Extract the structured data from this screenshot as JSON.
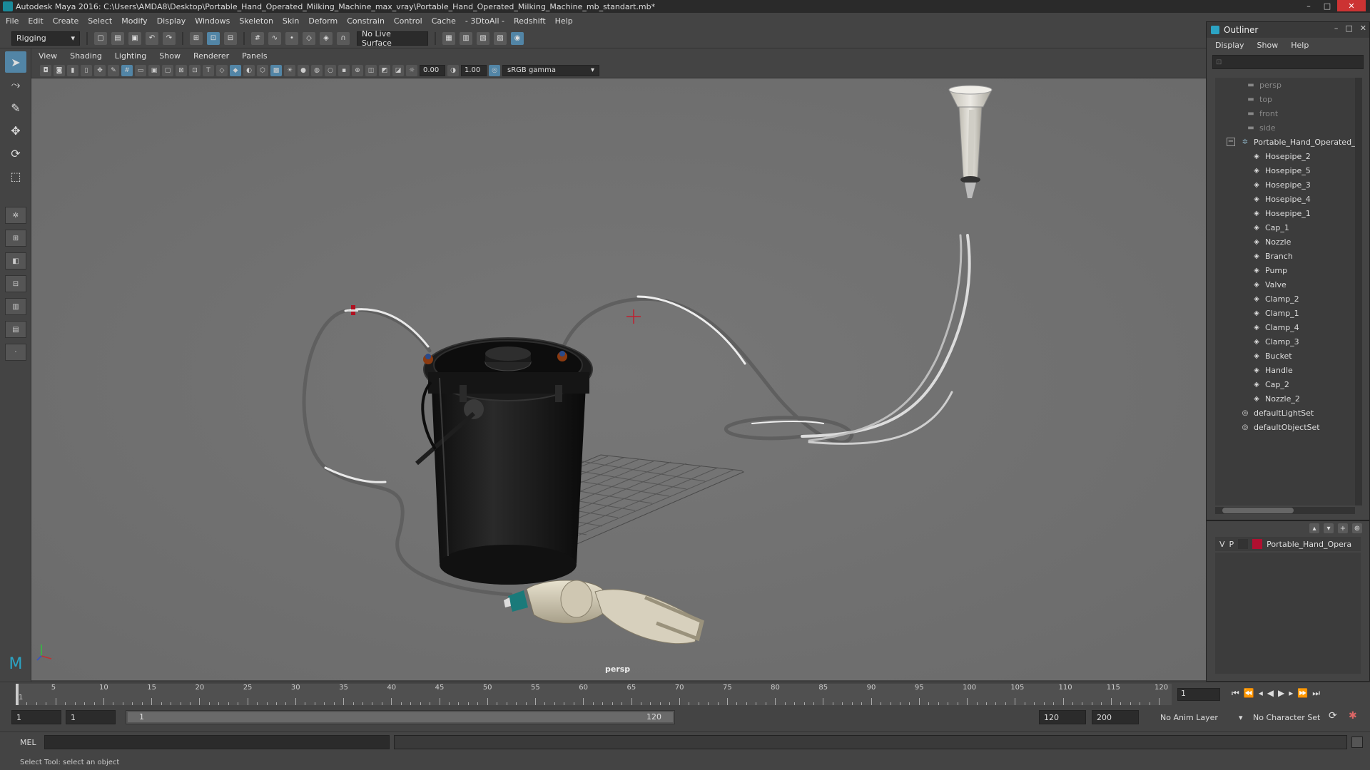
{
  "window": {
    "title": "Autodesk Maya 2016: C:\\Users\\AMDA8\\Desktop\\Portable_Hand_Operated_Milking_Machine_max_vray\\Portable_Hand_Operated_Milking_Machine_mb_standart.mb*",
    "controls": [
      "–",
      "□",
      "✕"
    ]
  },
  "menubar": [
    "File",
    "Edit",
    "Create",
    "Select",
    "Modify",
    "Display",
    "Windows",
    "Skeleton",
    "Skin",
    "Deform",
    "Constrain",
    "Control",
    "Cache",
    "- 3DtoAll -",
    "Redshift",
    "Help"
  ],
  "shelf": {
    "mode": "Rigging",
    "live_surface": "No Live Surface"
  },
  "viewport": {
    "menu": [
      "View",
      "Shading",
      "Lighting",
      "Show",
      "Renderer",
      "Panels"
    ],
    "exposure": "0.00",
    "gamma": "1.00",
    "color_space": "sRGB gamma",
    "camera": "persp"
  },
  "outliner": {
    "title": "Outliner",
    "controls": [
      "–",
      "□",
      "✕"
    ],
    "menu": [
      "Display",
      "Show",
      "Help"
    ],
    "cameras": [
      "persp",
      "top",
      "front",
      "side"
    ],
    "root": "Portable_Hand_Operated_",
    "children": [
      "Hosepipe_2",
      "Hosepipe_5",
      "Hosepipe_3",
      "Hosepipe_4",
      "Hosepipe_1",
      "Cap_1",
      "Nozzle",
      "Branch",
      "Pump",
      "Valve",
      "Clamp_2",
      "Clamp_1",
      "Clamp_4",
      "Clamp_3",
      "Bucket",
      "Handle",
      "Cap_2",
      "Nozzle_2"
    ],
    "sets": [
      "defaultLightSet",
      "defaultObjectSet"
    ]
  },
  "layers": {
    "visible": "V",
    "playback": "P",
    "name": "Portable_Hand_Opera",
    "color": "#b01030"
  },
  "timeline": {
    "ticks": [
      "1",
      "5",
      "10",
      "15",
      "20",
      "25",
      "30",
      "35",
      "40",
      "45",
      "50",
      "55",
      "60",
      "65",
      "70",
      "75",
      "80",
      "85",
      "90",
      "95",
      "100",
      "105",
      "110",
      "115",
      "120"
    ],
    "current_frame": "1"
  },
  "range": {
    "start": "1",
    "playback_start": "1",
    "slider_start": "1",
    "slider_end": "120",
    "playback_end": "120",
    "end": "200",
    "anim_layer": "No Anim Layer",
    "character_set": "No Character Set"
  },
  "command": {
    "language": "MEL"
  },
  "status": {
    "help_line": "Select Tool: select an object"
  }
}
